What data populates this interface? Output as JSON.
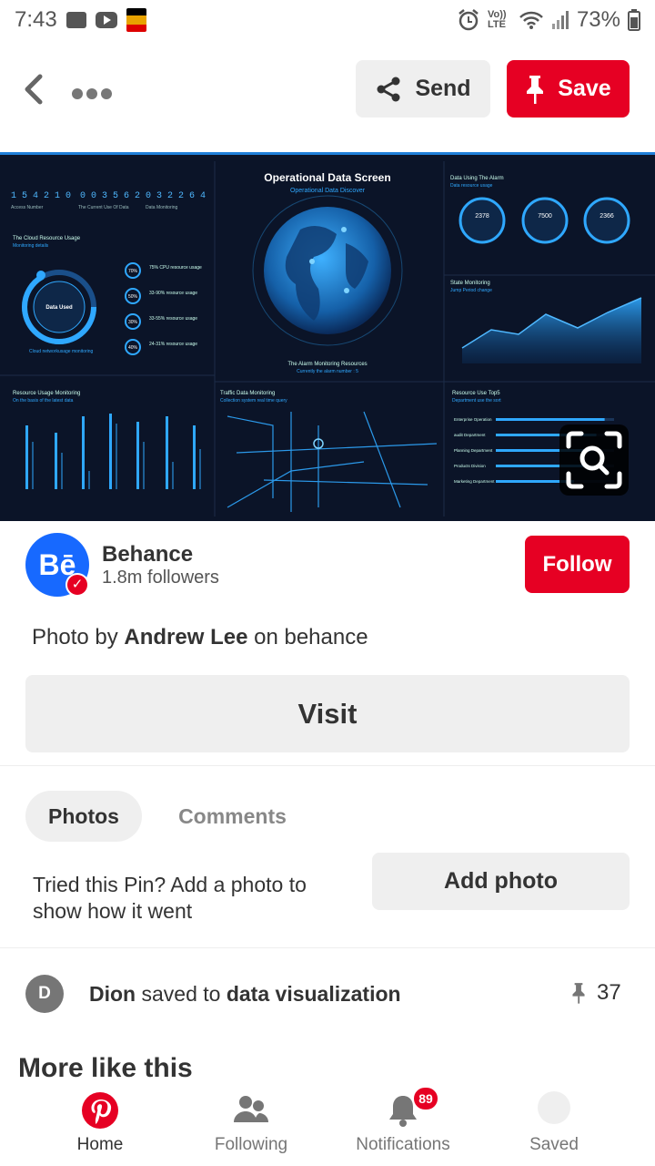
{
  "status_bar": {
    "time": "7:43",
    "network": "Vo)) LTE",
    "battery": "73%"
  },
  "top_bar": {
    "send_label": "Send",
    "save_label": "Save"
  },
  "pin_image": {
    "title": "Operational Data Screen",
    "subtitle": "Operational Data Discover",
    "counters": [
      "1 5 4 2 1 0",
      "0 0 3 5 6 2",
      "0 3 2 2 6 4"
    ],
    "counter_labels": [
      "Access Number",
      "The Current Use Of Data",
      "Data Monitoring"
    ],
    "left_panel_title": "The Cloud Resource Usage",
    "left_panel_sub": "Monitoring details",
    "data_used": "Data Used",
    "usage_items": [
      "75% CPU resource usage",
      "33-90% resource usage",
      "33-55% resource usage",
      "24-31% resource usage"
    ],
    "usage_pcts": [
      "70%",
      "50%",
      "30%",
      "40%"
    ],
    "cloud_footer": "Cloud networkusage monitoring",
    "alarm_title": "Data Using The Alarm",
    "alarm_sub": "Data resource usage",
    "alarm_values": [
      "2378",
      "7500",
      "2366"
    ],
    "state_title": "State Monitoring",
    "state_sub": "Jump Period change",
    "globe_footer": "The Alarm Monitoring Resources",
    "globe_footer_sub": "Currently the alarm number : 5",
    "resource_title": "Resource Usage Monitoring",
    "resource_sub": "On the basis of the latest data",
    "traffic_title": "Traffic Data Monitoring",
    "traffic_sub": "Collection system real time query",
    "top5_title": "Resource Use Top5",
    "top5_sub": "Department use the sort",
    "top5_items": [
      "Enterprise Operation",
      "audit Department",
      "Planning Department",
      "Products Division",
      "Marketing Department"
    ],
    "top5_pcts": [
      0.92,
      0.85,
      0.8,
      0.74,
      0.66
    ]
  },
  "author": {
    "name": "Behance",
    "initials": "Bē",
    "followers": "1.8m followers",
    "follow_label": "Follow"
  },
  "credit": {
    "prefix": "Photo by",
    "person": "Andrew Lee",
    "suffix": "on behance"
  },
  "visit_label": "Visit",
  "tabs": {
    "photos": "Photos",
    "comments": "Comments"
  },
  "tried": {
    "text": "Tried this Pin? Add a photo to show how it went",
    "add_photo_label": "Add photo"
  },
  "saved_by": {
    "initial": "D",
    "user": "Dion",
    "verb": "saved to",
    "board": "data visualization",
    "count": "37"
  },
  "more_like_this": "More like this",
  "bottom_nav": {
    "home": "Home",
    "following": "Following",
    "notifications": "Notifications",
    "notifications_badge": "89",
    "saved": "Saved"
  },
  "colors": {
    "brand_red": "#e60023",
    "behance_blue": "#1769ff",
    "dashboard_bg": "#0b1428",
    "dashboard_accent": "#2fa8ff"
  }
}
